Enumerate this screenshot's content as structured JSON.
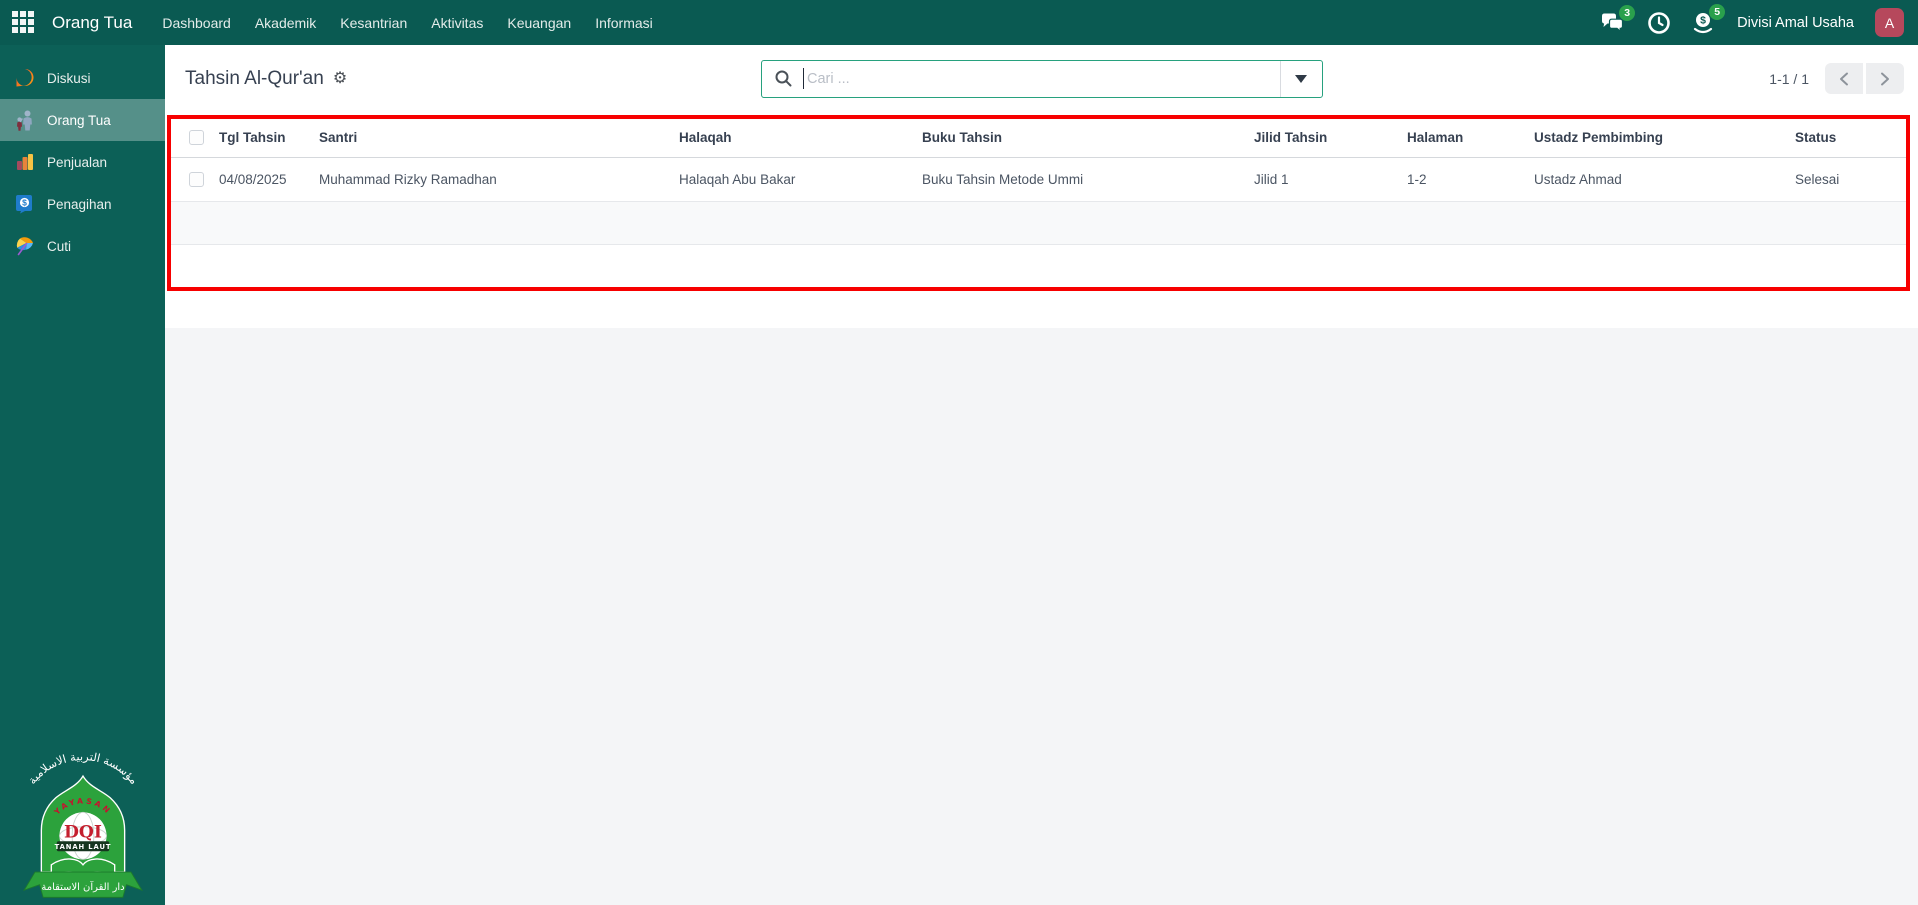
{
  "topbar": {
    "app_name": "Orang Tua",
    "menus": [
      "Dashboard",
      "Akademik",
      "Kesantrian",
      "Aktivitas",
      "Keuangan",
      "Informasi"
    ],
    "messages_badge": "3",
    "activities_badge": "5",
    "user_label": "Divisi Amal Usaha",
    "avatar_letter": "A"
  },
  "sidebar": {
    "items": [
      {
        "label": "Diskusi",
        "icon": "chat-bubble-icon"
      },
      {
        "label": "Orang Tua",
        "icon": "parents-icon"
      },
      {
        "label": "Penjualan",
        "icon": "bar-chart-icon"
      },
      {
        "label": "Penagihan",
        "icon": "invoice-dollar-icon"
      },
      {
        "label": "Cuti",
        "icon": "umbrella-icon"
      }
    ]
  },
  "control_panel": {
    "title": "Tahsin Al-Qur'an",
    "search_placeholder": "Cari ...",
    "pagination": "1-1 / 1"
  },
  "table": {
    "columns": [
      "Tgl Tahsin",
      "Santri",
      "Halaqah",
      "Buku Tahsin",
      "Jilid Tahsin",
      "Halaman",
      "Ustadz Pembimbing",
      "Status"
    ],
    "rows": [
      [
        "04/08/2025",
        "Muhammad Rizky Ramadhan",
        "Halaqah Abu Bakar",
        "Buku Tahsin Metode Ummi",
        "Jilid 1",
        "1-2",
        "Ustadz Ahmad",
        "Selesai"
      ]
    ]
  },
  "logo": {
    "arabic_top": "مؤسسة التربية الاسلامية",
    "yayasan": "YAYASAN",
    "acronym": "DQI",
    "region": "TANAH LAUT",
    "arabic_bottom": "دار القرآن الاستقامة"
  },
  "colors": {
    "topbar_teal": "#0a5a52",
    "sidebar_teal": "#0c6057",
    "search_border_green": "#27a17e",
    "annotation_red": "#f70000",
    "badge_green": "#2aa04c",
    "avatar_red": "#b6485c",
    "logo_green": "#2ca23c"
  }
}
